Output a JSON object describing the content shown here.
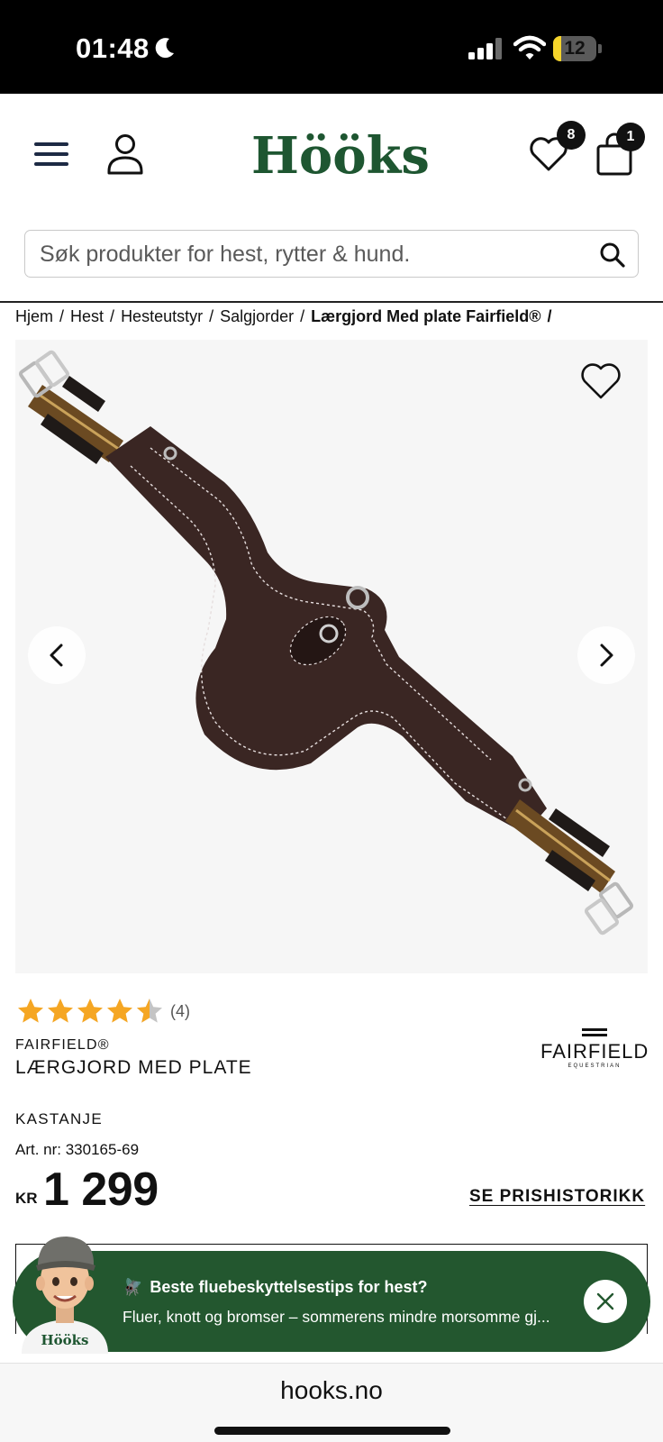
{
  "status_bar": {
    "time": "01:48",
    "battery": "12",
    "battery_level_percent": 12
  },
  "header": {
    "logo": "Hööks",
    "wishlist_count": "8",
    "cart_count": "1",
    "icons": [
      "menu-icon",
      "user-icon",
      "heart-icon",
      "bag-icon"
    ]
  },
  "search": {
    "placeholder": "Søk produkter for hest, rytter & hund."
  },
  "breadcrumb": {
    "items": [
      "Hjem",
      "Hest",
      "Hesteutstyr",
      "Salgjorder"
    ],
    "current": "Lærgjord Med plate Fairfield®",
    "separator": "/"
  },
  "product": {
    "rating": 4.5,
    "rating_count": "(4)",
    "brand": "FAIRFIELD®",
    "name": "LÆRGJORD MED PLATE",
    "brand_logo": "FAIRFIELD",
    "brand_logo_sub": "EQUESTRIAN",
    "color": "KASTANJE",
    "art_nr": "Art. nr: 330165-69",
    "currency": "KR",
    "price": "1 299",
    "price_history": "SE PRISHISTORIKK"
  },
  "promo": {
    "icon": "fly-emoji",
    "title": "Beste fluebeskyttelsestips for hest?",
    "text": "Fluer, knott og bromser – sommerens mindre morsomme gj...",
    "avatar_label": "Hööks"
  },
  "browser": {
    "url": "hooks.no"
  },
  "colors": {
    "brand_green": "#1e5631",
    "promo_green": "#23572f",
    "star": "#f5a623",
    "leather": "#3a2623"
  }
}
